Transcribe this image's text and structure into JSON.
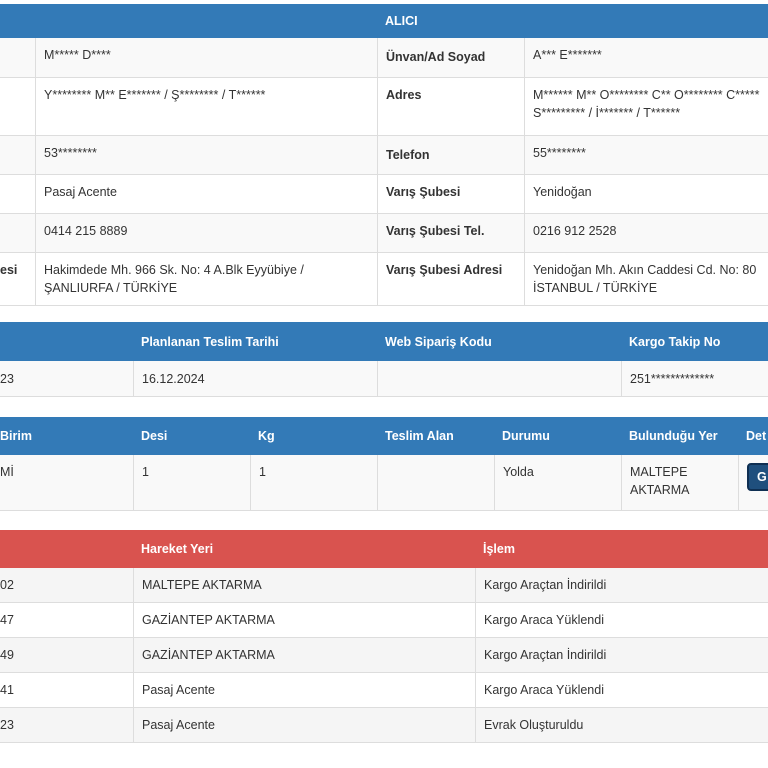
{
  "party": {
    "recipient_header": "ALICI",
    "rows": [
      {
        "left_label": "",
        "left_value": "M***** D****",
        "right_label": "Ünvan/Ad Soyad",
        "right_value": "A*** E*******"
      },
      {
        "left_label": "",
        "left_value": "Y******** M** E******* / Ş******** / T******",
        "right_label": "Adres",
        "right_value": "M****** M** O******** C** O******** C*****",
        "right_value2": "S********* / İ******* / T******"
      },
      {
        "left_label": "",
        "left_value": "53********",
        "right_label": "Telefon",
        "right_value": "55********"
      },
      {
        "left_label": "",
        "left_value": "Pasaj Acente",
        "right_label": "Varış Şubesi",
        "right_value": "Yenidoğan"
      },
      {
        "left_label": "",
        "left_value": "0414 215 8889",
        "right_label": "Varış Şubesi Tel.",
        "right_value": "0216 912 2528"
      },
      {
        "left_label": "esi",
        "left_value": "Hakimdede Mh. 966 Sk. No: 4 A.Blk Eyyübiye /",
        "left_value2": "ŞANLIURFA / TÜRKİYE",
        "right_label": "Varış Şubesi Adresi",
        "right_value": "Yenidoğan Mh. Akın Caddesi Cd. No: 80",
        "right_value2": "İSTANBUL / TÜRKİYE"
      }
    ]
  },
  "shipment": {
    "headers": [
      "",
      "Planlanan Teslim Tarihi",
      "Web Sipariş Kodu",
      "Kargo Takip No"
    ],
    "row": [
      "23",
      "16.12.2024",
      "",
      "251*************"
    ]
  },
  "status": {
    "headers": [
      "Birim",
      "Desi",
      "Kg",
      "Teslim Alan",
      "Durumu",
      "Bulunduğu Yer",
      "Det"
    ],
    "row": [
      "Mİ",
      "1",
      "1",
      "",
      "Yolda",
      "MALTEPE",
      "G"
    ],
    "location_line2": "AKTARMA"
  },
  "movements": {
    "headers": [
      "",
      "Hareket Yeri",
      "İşlem"
    ],
    "rows": [
      [
        "02",
        "MALTEPE AKTARMA",
        "Kargo Araçtan İndirildi"
      ],
      [
        "47",
        "GAZİANTEP AKTARMA",
        "Kargo Araca Yüklendi"
      ],
      [
        "49",
        "GAZİANTEP AKTARMA",
        "Kargo Araçtan İndirildi"
      ],
      [
        "41",
        "Pasaj Acente",
        "Kargo Araca Yüklendi"
      ],
      [
        "23",
        "Pasaj Acente",
        "Evrak Oluşturuldu"
      ]
    ]
  },
  "colors": {
    "header_blue": "#337ab7",
    "header_red": "#d9534f",
    "detail_button": "#1f4f7d"
  }
}
